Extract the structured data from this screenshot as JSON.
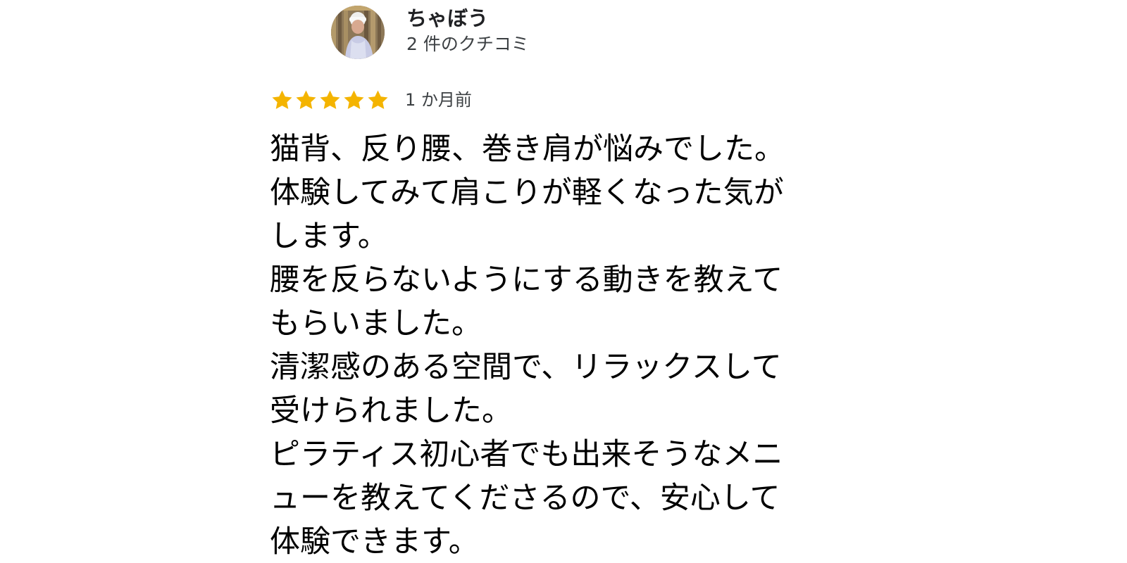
{
  "reviewer": {
    "name": "ちゃぼう",
    "review_count": "2 件のクチコミ",
    "avatar_icon": "profile-photo"
  },
  "rating": {
    "stars": 5,
    "max_stars": 5,
    "star_color": "#f4b400",
    "date": "1 か月前"
  },
  "review": {
    "lines": [
      "猫背、反り腰、巻き肩が悩みでした。",
      "体験してみて肩こりが軽くなった気が",
      "します。",
      "腰を反らないようにする動きを教えて",
      "もらいました。",
      "清潔感のある空間で、リラックスして",
      "受けられました。",
      "ピラティス初心者でも出来そうなメニ",
      "ューを教えてくださるので、安心して",
      "体験できます。"
    ]
  }
}
